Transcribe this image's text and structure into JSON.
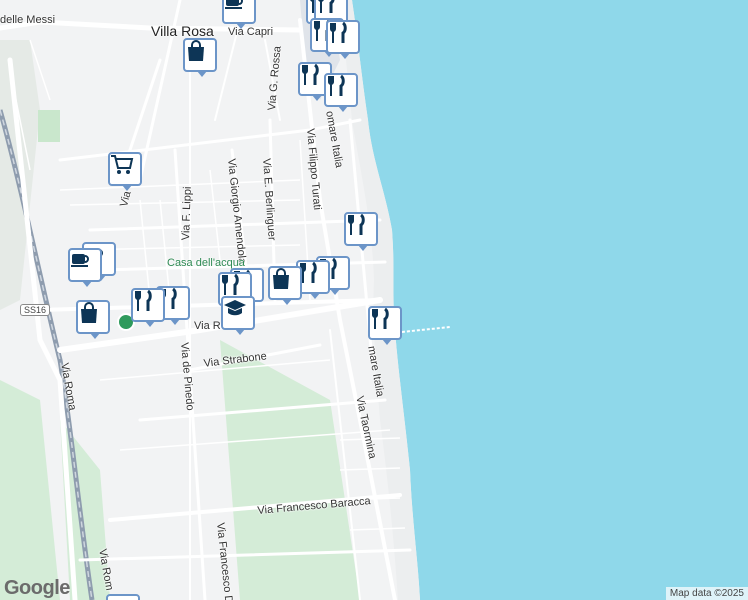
{
  "map": {
    "place_labels": {
      "town": "Villa Rosa",
      "via_delle_messi": "delle Messi",
      "via_capri": "Via Capri",
      "via_g_rossa": "Via G. Rossa",
      "lungomare_top": "omare Italia",
      "lungomare_bottom": "mare Italia",
      "via_filippo_turati": "Via Filippo Turati",
      "via_e_berlinguer": "Via E. Berlinguer",
      "via_giorgio_amendola": "Via Giorgio Amendola",
      "via_f_lippi": "Via F. Lippi",
      "via_left_partial": "Via",
      "casa_dell_acqua": "Casa dell'acqua",
      "via_main": "Via R",
      "via_strabone": "Via Strabone",
      "via_de_pinedo": "Via de Pinedo",
      "via_taormina": "Via Taormina",
      "via_roma": "Via Roma",
      "via_roma_bottom": "Via Rom",
      "via_francesco_baracca": "Via Francesco Baracca",
      "via_francesco_d": "Via Francesco D"
    },
    "road_badge": "SS16",
    "google_logo": "Google",
    "attribution": "Map data ©2025",
    "colors": {
      "sea": "#8fd8ea",
      "land": "#f2f3f4",
      "park": "#d4ecd7",
      "road": "#ffffff",
      "railway": "#8e9cae",
      "pin_border": "#6c95c8",
      "icon": "#0d3556"
    },
    "markers": [
      {
        "name": "cafe-icon",
        "type": "cafe"
      },
      {
        "name": "restaurant-icon",
        "type": "restaurant"
      },
      {
        "name": "restaurant-icon",
        "type": "restaurant"
      },
      {
        "name": "shopping-bag-icon",
        "type": "shop"
      },
      {
        "name": "restaurant-icon",
        "type": "restaurant"
      },
      {
        "name": "restaurant-icon",
        "type": "restaurant"
      },
      {
        "name": "restaurant-icon",
        "type": "restaurant"
      },
      {
        "name": "shopping-cart-icon",
        "type": "supermarket"
      },
      {
        "name": "restaurant-icon",
        "type": "restaurant"
      },
      {
        "name": "cafe-icon",
        "type": "cafe"
      },
      {
        "name": "cafe-icon",
        "type": "cafe"
      },
      {
        "name": "restaurant-icon",
        "type": "restaurant"
      },
      {
        "name": "shopping-bag-icon",
        "type": "shop"
      },
      {
        "name": "restaurant-icon",
        "type": "restaurant"
      },
      {
        "name": "restaurant-icon",
        "type": "restaurant"
      },
      {
        "name": "restaurant-icon",
        "type": "restaurant"
      },
      {
        "name": "shopping-bag-icon",
        "type": "shop"
      },
      {
        "name": "restaurant-icon",
        "type": "restaurant"
      },
      {
        "name": "restaurant-icon",
        "type": "restaurant"
      },
      {
        "name": "school-icon",
        "type": "school"
      },
      {
        "name": "restaurant-icon",
        "type": "restaurant"
      }
    ]
  }
}
